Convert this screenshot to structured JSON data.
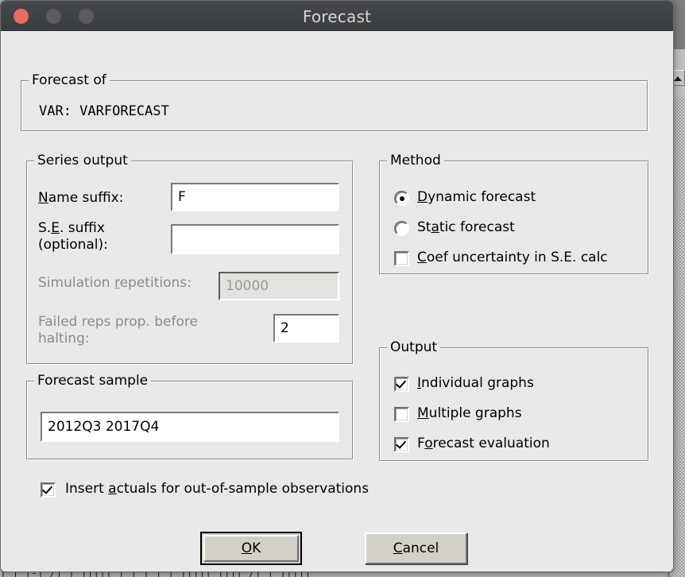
{
  "window": {
    "title": "Forecast",
    "traffic_lights": [
      "close",
      "minimize",
      "zoom"
    ],
    "colors": {
      "titlebar": "#3c3f41",
      "title_text": "#d4d4d4",
      "close": "#ec6a5e",
      "inactive": "#5a5c5e",
      "dialog_face": "#e8e8e8",
      "disabled_text": "#8c8c8c"
    }
  },
  "forecast_of": {
    "legend": "Forecast of",
    "line": "VAR:   VARFORECAST"
  },
  "series_output": {
    "legend": "Series output",
    "name_suffix": {
      "label_pre": "N",
      "label_post": "ame suffix:",
      "value": "F"
    },
    "se_suffix": {
      "label_line1_pre": "S.",
      "label_line1_mid": "E",
      "label_line1_post": ". suffix",
      "label_line2": "(optional):",
      "value": ""
    },
    "simulation_repetitions": {
      "label_pre": "Simulation ",
      "label_mid": "r",
      "label_post": "epetitions:",
      "value": "10000",
      "enabled": false
    },
    "failed_reps": {
      "label_line1": "Failed reps prop. before",
      "label_line2": "halting:",
      "value": "2",
      "enabled": false
    }
  },
  "method": {
    "legend": "Method",
    "options": [
      {
        "label_pre": "D",
        "label_post": "ynamic forecast",
        "selected": true
      },
      {
        "label_pre": "St",
        "label_mnemonic": "a",
        "label_post": "tic forecast",
        "selected": false
      }
    ],
    "coef_uncertainty": {
      "label_pre": "C",
      "label_post": "oef uncertainty in S.E. calc",
      "checked": false
    }
  },
  "output": {
    "legend": "Output",
    "items": [
      {
        "label_pre": "I",
        "label_post": "ndividual graphs",
        "checked": true
      },
      {
        "label_pre": "M",
        "label_post": "ultiple graphs",
        "checked": false
      },
      {
        "label_pre": "F",
        "label_mnemonic": "o",
        "label_post": "recast evaluation",
        "checked": true
      }
    ]
  },
  "forecast_sample": {
    "legend": "Forecast sample",
    "value": "2012Q3 2017Q4"
  },
  "insert_actuals": {
    "label_pre": "Insert ",
    "label_mnemonic": "a",
    "label_post": "ctuals for out-of-sample observations",
    "checked": true
  },
  "buttons": {
    "ok": {
      "pre": "O",
      "post": "K",
      "default": true
    },
    "cancel": {
      "pre": "C",
      "post": "ancel",
      "default": false
    }
  },
  "background": {
    "clipped_text": "| | |-| /|          |'|||||'|'|'|          |'| ||||| ||||          /| | |||||"
  }
}
